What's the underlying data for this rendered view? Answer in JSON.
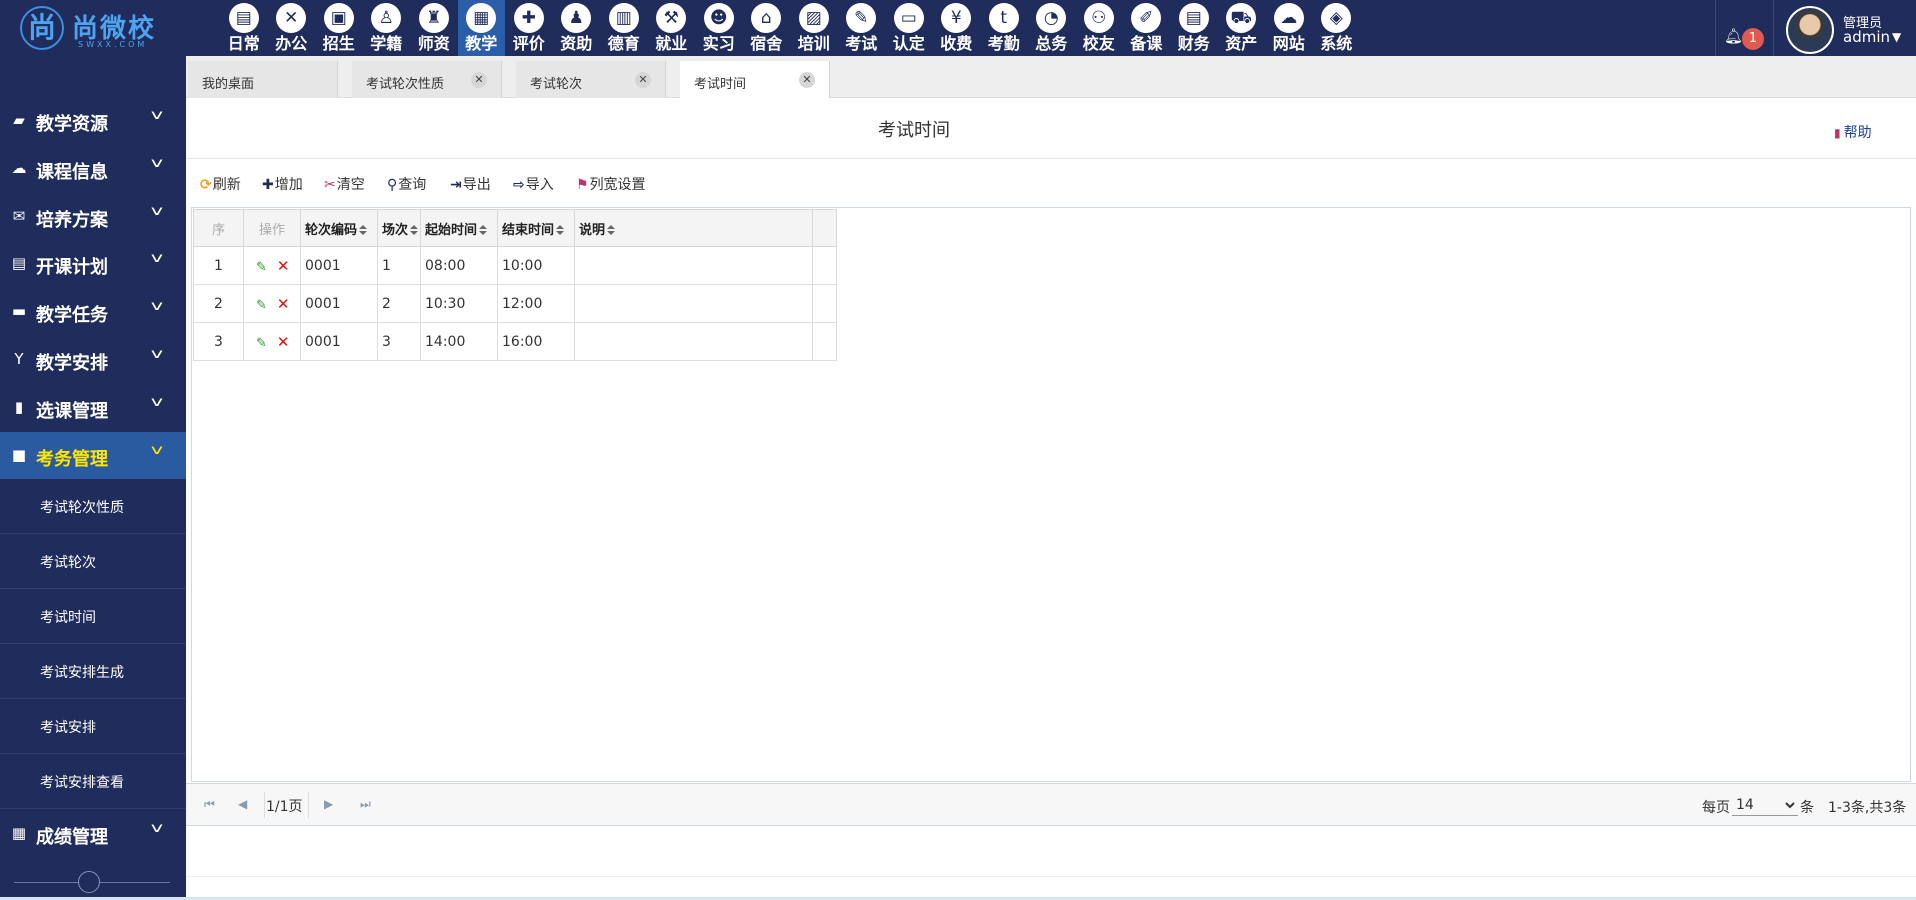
{
  "brand": {
    "name": "尚微校",
    "sub": "SWXX.COM",
    "emblem": "尚"
  },
  "modules": [
    {
      "label": "日常",
      "icon": "▤"
    },
    {
      "label": "办公",
      "icon": "✕"
    },
    {
      "label": "招生",
      "icon": "▣"
    },
    {
      "label": "学籍",
      "icon": "♙"
    },
    {
      "label": "师资",
      "icon": "♜"
    },
    {
      "label": "教学",
      "icon": "▦"
    },
    {
      "label": "评价",
      "icon": "✚"
    },
    {
      "label": "资助",
      "icon": "♟"
    },
    {
      "label": "德育",
      "icon": "▥"
    },
    {
      "label": "就业",
      "icon": "⚒"
    },
    {
      "label": "实习",
      "icon": "☻"
    },
    {
      "label": "宿舍",
      "icon": "⌂"
    },
    {
      "label": "培训",
      "icon": "▨"
    },
    {
      "label": "考试",
      "icon": "✎"
    },
    {
      "label": "认定",
      "icon": "▭"
    },
    {
      "label": "收费",
      "icon": "¥"
    },
    {
      "label": "考勤",
      "icon": "t"
    },
    {
      "label": "总务",
      "icon": "◔"
    },
    {
      "label": "校友",
      "icon": "⚇"
    },
    {
      "label": "备课",
      "icon": "✐"
    },
    {
      "label": "财务",
      "icon": "▤"
    },
    {
      "label": "资产",
      "icon": "⛟"
    },
    {
      "label": "网站",
      "icon": "☁"
    },
    {
      "label": "系统",
      "icon": "◈"
    }
  ],
  "user": {
    "notifications": "1",
    "role": "管理员",
    "name": "admin"
  },
  "sidebar": {
    "groups": [
      {
        "label": "教学资源",
        "icon": "▰"
      },
      {
        "label": "课程信息",
        "icon": "☁"
      },
      {
        "label": "培养方案",
        "icon": "✉"
      },
      {
        "label": "开课计划",
        "icon": "▤"
      },
      {
        "label": "教学任务",
        "icon": "▬"
      },
      {
        "label": "教学安排",
        "icon": "Y"
      },
      {
        "label": "选课管理",
        "icon": "▮"
      },
      {
        "label": "考务管理",
        "icon": "■"
      }
    ],
    "subitems": [
      {
        "label": "考试轮次性质"
      },
      {
        "label": "考试轮次"
      },
      {
        "label": "考试时间"
      },
      {
        "label": "考试安排生成"
      },
      {
        "label": "考试安排"
      },
      {
        "label": "考试安排查看"
      }
    ],
    "last_group": {
      "label": "成绩管理",
      "icon": "▦"
    }
  },
  "tabs": [
    {
      "label": "我的桌面",
      "closable": false
    },
    {
      "label": "考试轮次性质",
      "closable": true
    },
    {
      "label": "考试轮次",
      "closable": true
    },
    {
      "label": "考试时间",
      "closable": true
    }
  ],
  "page": {
    "title": "考试时间",
    "help": "帮助"
  },
  "toolbar": {
    "refresh": "刷新",
    "add": "增加",
    "clear": "清空",
    "query": "查询",
    "export": "导出",
    "import": "导入",
    "column_width": "列宽设置"
  },
  "grid": {
    "headers": {
      "seq": "序",
      "actions": "操作",
      "round_code": "轮次编码",
      "session": "场次",
      "start": "起始时间",
      "end": "结束时间",
      "desc": "说明"
    },
    "rows": [
      {
        "seq": "1",
        "round_code": "0001",
        "session": "1",
        "start": "08:00",
        "end": "10:00",
        "desc": ""
      },
      {
        "seq": "2",
        "round_code": "0001",
        "session": "2",
        "start": "10:30",
        "end": "12:00",
        "desc": ""
      },
      {
        "seq": "3",
        "round_code": "0001",
        "session": "3",
        "start": "14:00",
        "end": "16:00",
        "desc": ""
      }
    ]
  },
  "pager": {
    "page_info": "1/1页",
    "per_page_label": "每页",
    "per_page": "14",
    "unit": "条",
    "range": "1-3条,共3条"
  }
}
